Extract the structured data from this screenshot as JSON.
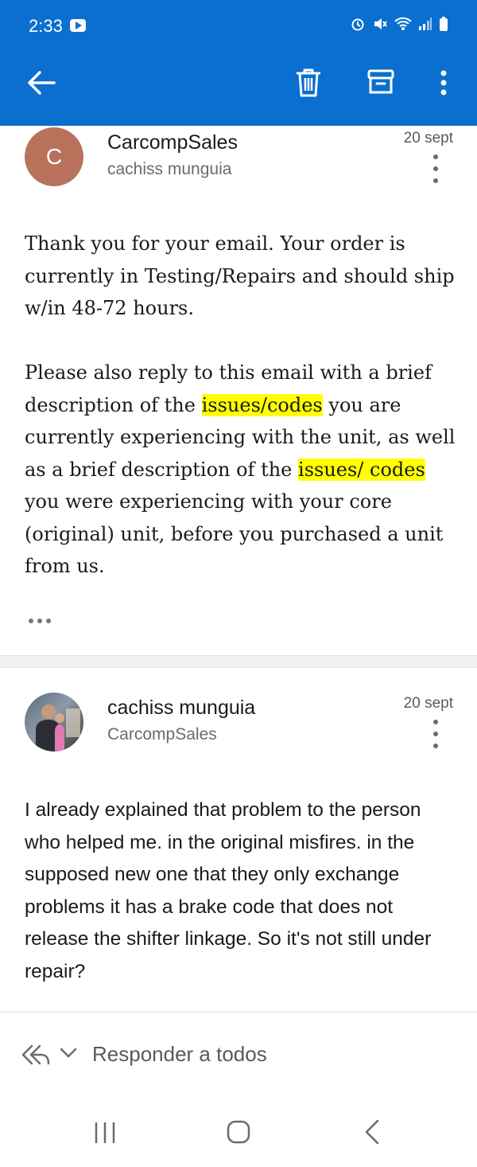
{
  "status_bar": {
    "time": "2:33"
  },
  "toolbar": {
    "back_icon": "arrow-left-icon",
    "delete_icon": "trash-icon",
    "archive_icon": "archive-icon",
    "more_icon": "vertical-ellipsis-icon"
  },
  "colors": {
    "header": "#0a6fcf",
    "highlight": "#ffff00",
    "avatar_letter_bg": "#b8725c"
  },
  "messages": [
    {
      "avatar_letter": "C",
      "sender": "CarcompSales",
      "recipient": "cachiss munguia",
      "date": "20 sept",
      "p1": "Thank you for your email.  Your order is currently in Testing/Repairs and should ship w/in 48-72 hours.",
      "p2_a": "Please also reply to this email with a brief description of the ",
      "hl1": "issues/codes",
      "p2_b": " you are currently experiencing with the unit, as well as a brief description of the ",
      "hl2": "issues/ codes",
      "p2_c": " you were experiencing with your core (original) unit, before you purchased a unit from us."
    },
    {
      "sender": "cachiss munguia",
      "recipient": "CarcompSales",
      "date": "20 sept",
      "body": "I already explained that problem to the person who helped me.  in the original misfires. in the supposed new one that they only exchange problems it has a brake code that does not release the shifter linkage. So it's not still under repair?"
    }
  ],
  "reply_bar": {
    "label": "Responder a todos"
  }
}
